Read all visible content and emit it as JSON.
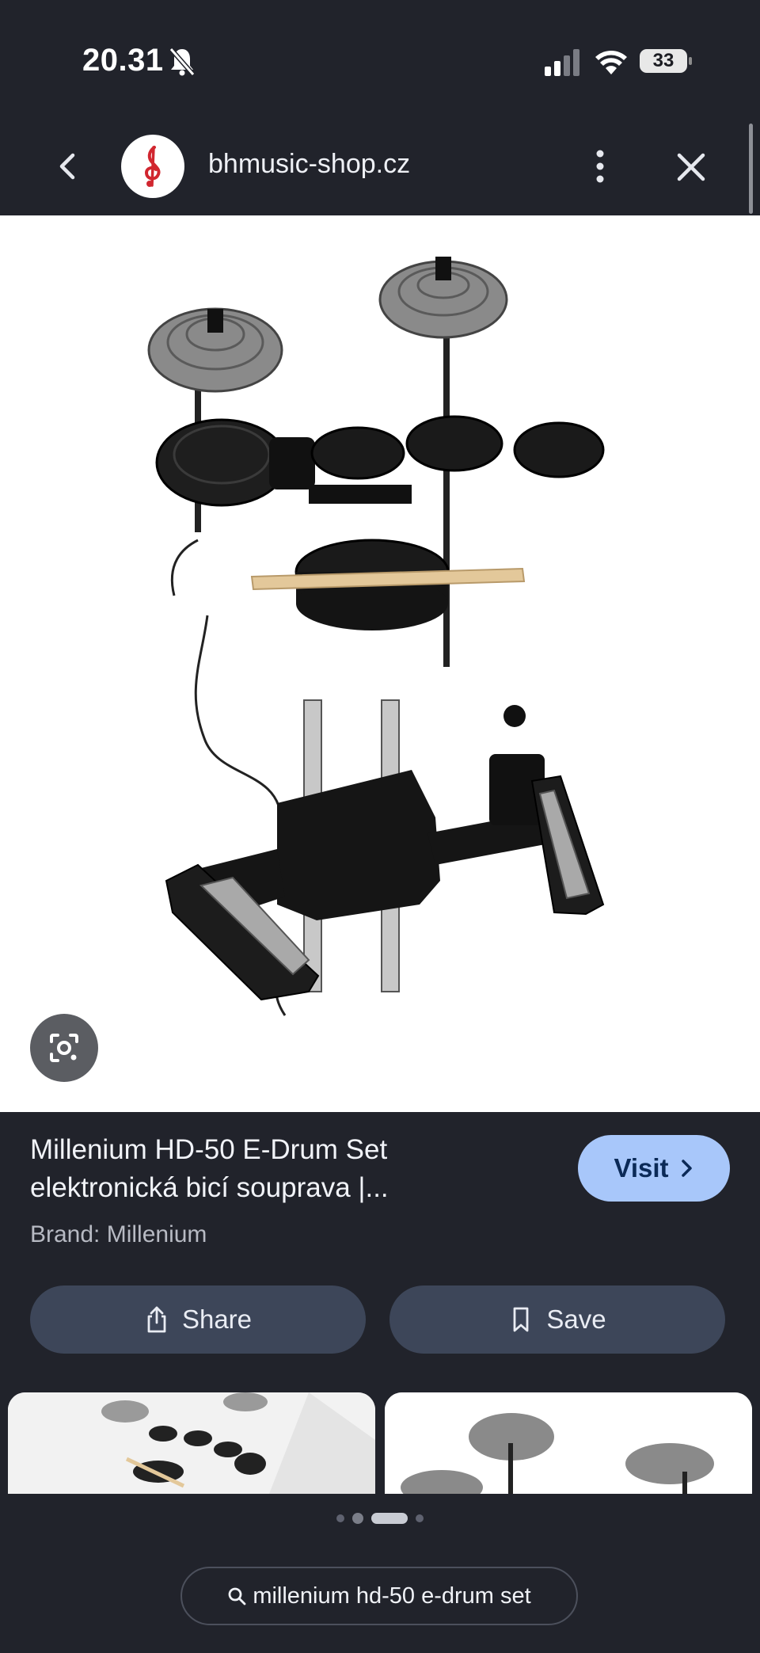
{
  "status_bar": {
    "time": "20.31",
    "battery": "33",
    "icons": [
      "bell-muted-icon",
      "signal-icon",
      "wifi-icon",
      "battery-icon"
    ]
  },
  "browser": {
    "domain": "bhmusic-shop.cz",
    "icons": [
      "back-icon",
      "treble-clef-favicon",
      "more-vert-icon",
      "close-icon"
    ]
  },
  "result": {
    "title_line1": "Millenium HD-50 E-Drum Set",
    "title_line2": "elektronická bicí souprava |...",
    "brand": "Brand: Millenium",
    "visit_label": "Visit",
    "share_label": "Share",
    "save_label": "Save"
  },
  "carousel": {
    "dots": 4,
    "active_index": 2
  },
  "search": {
    "query": "millenium hd-50 e-drum set"
  },
  "colors": {
    "background": "#21232b",
    "visit_button": "#a8c7fa",
    "action_button": "#3d4659"
  }
}
